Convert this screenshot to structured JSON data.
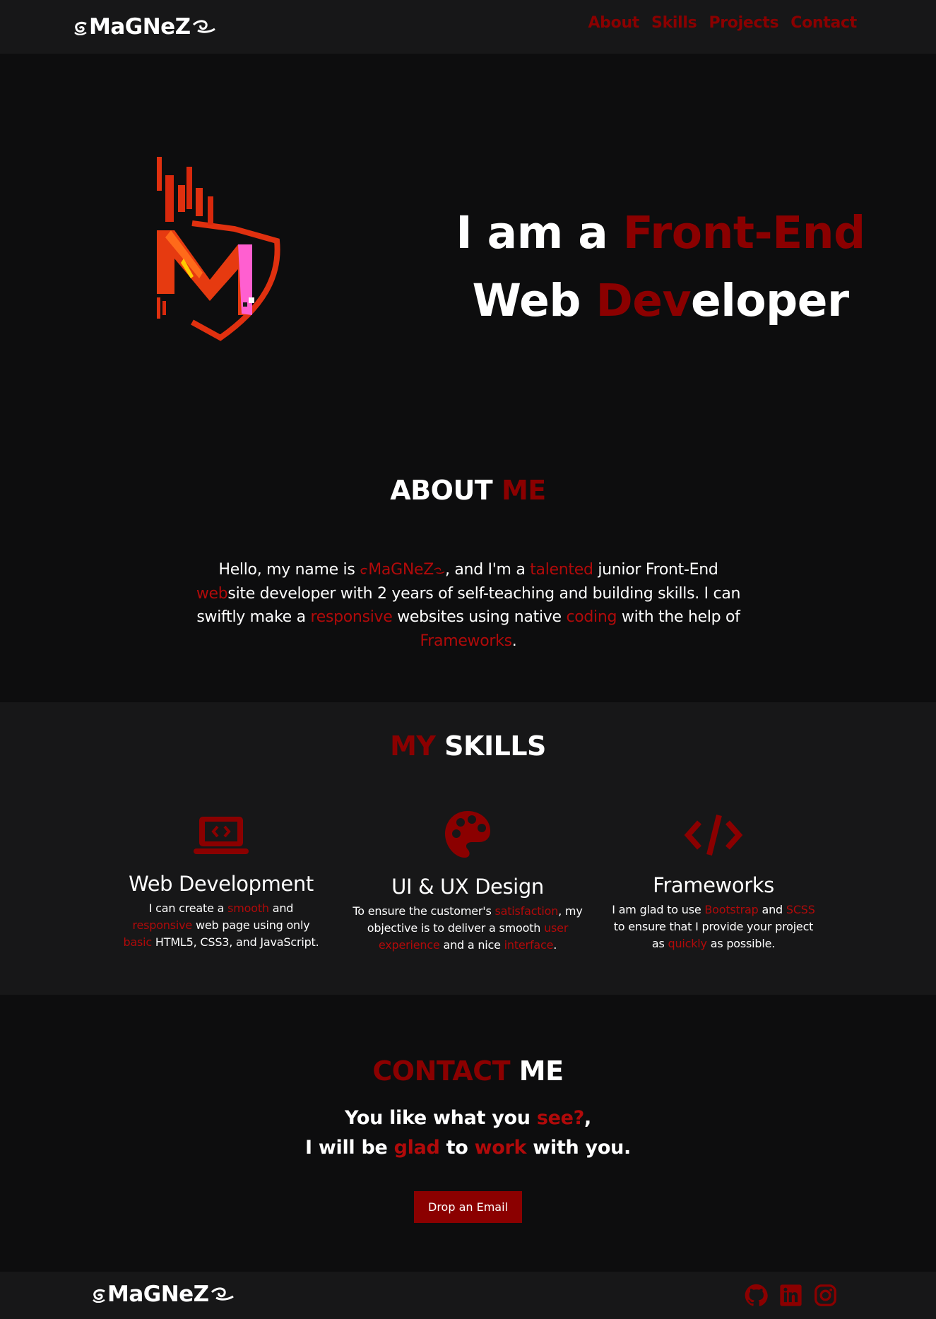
{
  "brand": {
    "name": "MaGNeZ"
  },
  "colors": {
    "accent": "#8b0000",
    "accent_bright": "#b10a0a",
    "background": "#0d0d0e",
    "panel": "#171718"
  },
  "nav": {
    "links": [
      "About",
      "Skills",
      "Projects",
      "Contact"
    ]
  },
  "hero": {
    "line1_white": "I am a ",
    "line1_red": "Front-End",
    "line2_white1": "Web ",
    "line2_red": "Dev",
    "line2_white2": "eloper"
  },
  "about": {
    "heading_white": "ABOUT ",
    "heading_red": "ME",
    "p1": "Hello, my name is ",
    "name": "MaGNeZ",
    "p2": ", and I'm a ",
    "w_talented": "talented",
    "p3": " junior Front-End ",
    "w_web": "web",
    "p4": "site developer with 2 years of self-teaching and building skills. I can swiftly make a ",
    "w_responsive": "responsive",
    "p5": " websites using native ",
    "w_coding": "coding",
    "p6": " with the help of ",
    "w_frameworks": "Frameworks",
    "p7": "."
  },
  "skills": {
    "heading_red": "MY",
    "heading_white": " SKILLS",
    "items": [
      {
        "icon": "laptop-code-icon",
        "title": "Web Development",
        "d1": "I can create a ",
        "r1": "smooth",
        "d2": " and ",
        "r2": "responsive",
        "d3": " web page using only ",
        "r3": "basic",
        "d4": " HTML5, CSS3, and JavaScript."
      },
      {
        "icon": "palette-icon",
        "title": "UI & UX Design",
        "d1": "To ensure the customer's ",
        "r1": "satisfaction",
        "d2": ", my objective is to deliver a smooth ",
        "r2": "user experience",
        "d3": " and a nice ",
        "r3": "interface",
        "d4": "."
      },
      {
        "icon": "code-icon",
        "title": "Frameworks",
        "d1": "I am glad to use ",
        "r1": "Bootstrap",
        "d2": " and ",
        "r2": "SCSS",
        "d3": " to ensure that I provide your project as ",
        "r3": "quickly",
        "d4": " as possible."
      }
    ]
  },
  "contact": {
    "heading_red": "CONTACT",
    "heading_white": " ME",
    "l1a": "You like what you ",
    "l1r": "see?",
    "l1b": ",",
    "l2a": "I will be ",
    "l2r1": "glad",
    "l2b": " to ",
    "l2r2": "work",
    "l2c": " with you.",
    "button": "Drop an Email"
  },
  "footer": {
    "social": [
      "github-icon",
      "linkedin-icon",
      "instagram-icon"
    ]
  }
}
